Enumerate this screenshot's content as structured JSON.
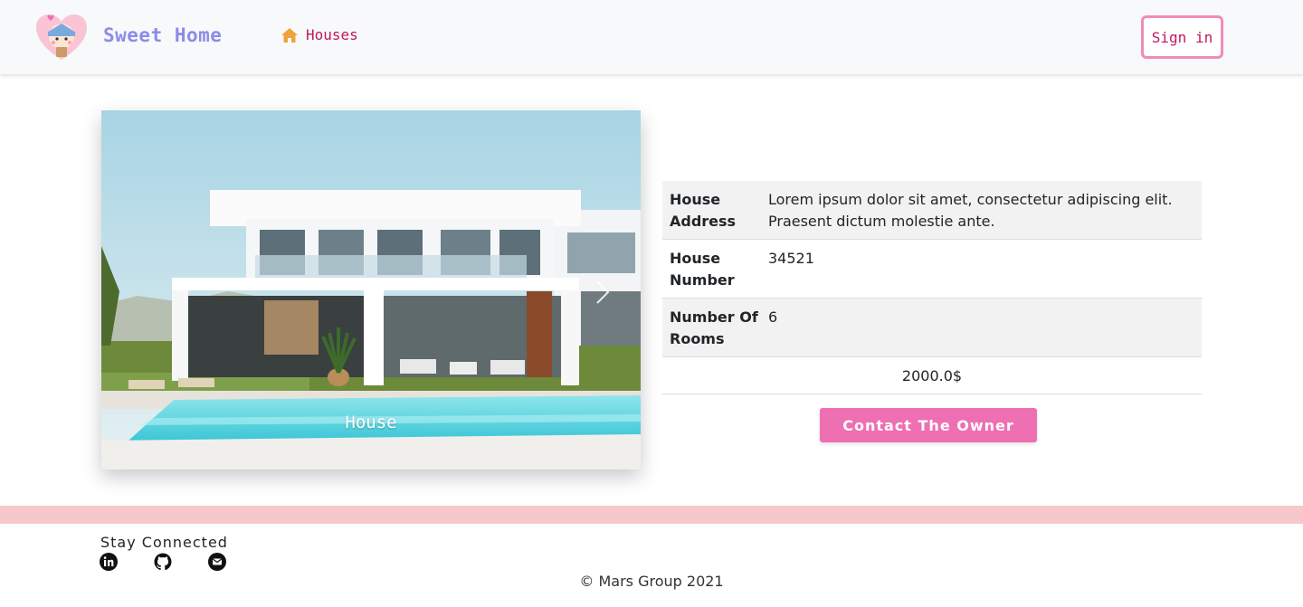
{
  "header": {
    "brand_name": "Sweet Home",
    "nav_houses_label": "Houses",
    "signin_label": "Sign in"
  },
  "carousel": {
    "caption": "House"
  },
  "details": {
    "rows": [
      {
        "label": "House Address",
        "value": "Lorem ipsum dolor sit amet, consectetur adipiscing elit. Praesent dictum molestie ante."
      },
      {
        "label": "House Number",
        "value": "34521"
      },
      {
        "label": "Number Of Rooms",
        "value": "6"
      }
    ],
    "price": "2000.0$",
    "contact_label": "Contact The Owner"
  },
  "footer": {
    "stay_connected": "Stay Connected",
    "copyright": "© Mars Group 2021",
    "social_icons": [
      "linkedin-icon",
      "github-icon",
      "email-icon"
    ]
  },
  "colors": {
    "brand": "#8c8be8",
    "link": "#c2185b",
    "accent_pink": "#ef6fb3",
    "signin_border": "#f08cb8",
    "footer_band": "#f7c8cb"
  }
}
